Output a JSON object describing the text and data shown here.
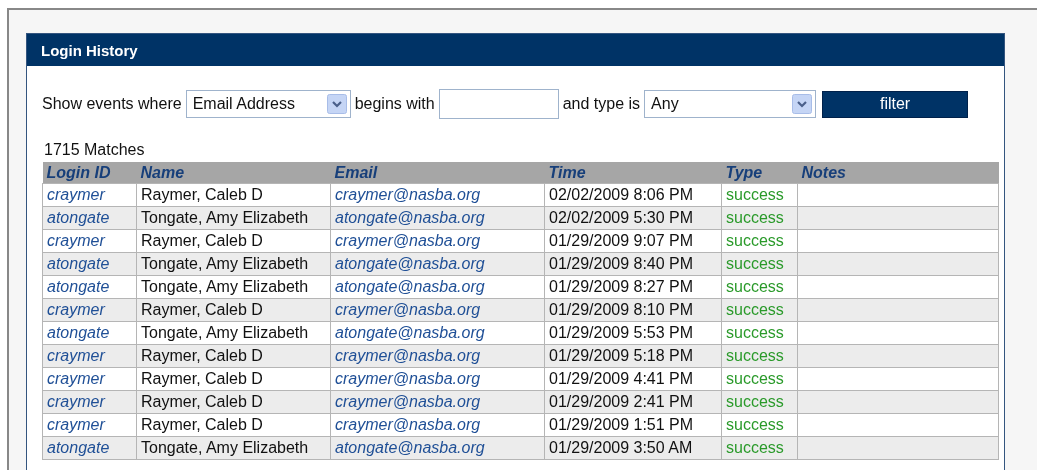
{
  "panel": {
    "title": "Login History"
  },
  "filter": {
    "prefix": "Show events where",
    "field_select": "Email Address",
    "middle": "begins with",
    "type_label": "and type is",
    "type_select": "Any",
    "button": "filter"
  },
  "matches": "1715 Matches",
  "table": {
    "columns": [
      "Login ID",
      "Name",
      "Email",
      "Time",
      "Type",
      "Notes"
    ],
    "rows": [
      {
        "login_id": "craymer",
        "name": "Raymer, Caleb D",
        "email": "craymer@nasba.org",
        "time": "02/02/2009 8:06 PM",
        "type": "success"
      },
      {
        "login_id": "atongate",
        "name": "Tongate, Amy Elizabeth",
        "email": "atongate@nasba.org",
        "time": "02/02/2009 5:30 PM",
        "type": "success"
      },
      {
        "login_id": "craymer",
        "name": "Raymer, Caleb D",
        "email": "craymer@nasba.org",
        "time": "01/29/2009 9:07 PM",
        "type": "success"
      },
      {
        "login_id": "atongate",
        "name": "Tongate, Amy Elizabeth",
        "email": "atongate@nasba.org",
        "time": "01/29/2009 8:40 PM",
        "type": "success"
      },
      {
        "login_id": "atongate",
        "name": "Tongate, Amy Elizabeth",
        "email": "atongate@nasba.org",
        "time": "01/29/2009 8:27 PM",
        "type": "success"
      },
      {
        "login_id": "craymer",
        "name": "Raymer, Caleb D",
        "email": "craymer@nasba.org",
        "time": "01/29/2009 8:10 PM",
        "type": "success"
      },
      {
        "login_id": "atongate",
        "name": "Tongate, Amy Elizabeth",
        "email": "atongate@nasba.org",
        "time": "01/29/2009 5:53 PM",
        "type": "success"
      },
      {
        "login_id": "craymer",
        "name": "Raymer, Caleb D",
        "email": "craymer@nasba.org",
        "time": "01/29/2009 5:18 PM",
        "type": "success"
      },
      {
        "login_id": "craymer",
        "name": "Raymer, Caleb D",
        "email": "craymer@nasba.org",
        "time": "01/29/2009 4:41 PM",
        "type": "success"
      },
      {
        "login_id": "craymer",
        "name": "Raymer, Caleb D",
        "email": "craymer@nasba.org",
        "time": "01/29/2009 2:41 PM",
        "type": "success"
      },
      {
        "login_id": "craymer",
        "name": "Raymer, Caleb D",
        "email": "craymer@nasba.org",
        "time": "01/29/2009 1:51 PM",
        "type": "success"
      },
      {
        "login_id": "atongate",
        "name": "Tongate, Amy Elizabeth",
        "email": "atongate@nasba.org",
        "time": "01/29/2009 3:50 AM",
        "type": "success"
      }
    ]
  }
}
